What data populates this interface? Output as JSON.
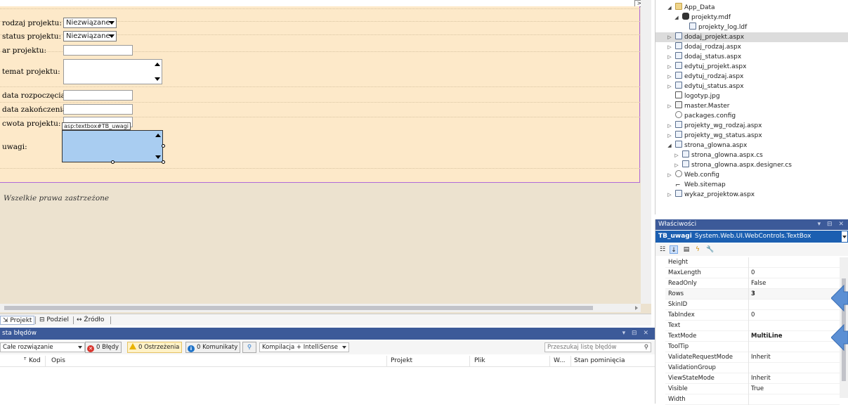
{
  "designer": {
    "glyph": ">",
    "form": [
      {
        "label": "rodzaj projektu:",
        "kind": "select",
        "value": "Niezwiązane"
      },
      {
        "label": "status projektu:",
        "kind": "select",
        "value": "Niezwiązane"
      },
      {
        "label": "ar projektu:",
        "kind": "textbox",
        "value": ""
      },
      {
        "label": "temat projektu:",
        "kind": "multiline",
        "value": ""
      },
      {
        "label": "data rozpoczęcia:",
        "kind": "textbox",
        "value": ""
      },
      {
        "label": "data zakończenia:",
        "kind": "textbox",
        "value": ""
      },
      {
        "label": "cwota projektu:",
        "kind": "textbox",
        "value": ""
      },
      {
        "label": "uwagi:",
        "kind": "multiline-selected",
        "value": ""
      }
    ],
    "selected_tag": "asp:textbox#TB_uwagi",
    "footer_text": "Wszelkie prawa zastrzeżone"
  },
  "view_tabs": {
    "projekt": "Projekt",
    "podziel": "Podziel",
    "zrodlo": "Źródło",
    "projekt_icon": "design-view-icon",
    "podziel_icon": "split-view-icon",
    "zrodlo_icon": "source-view-icon"
  },
  "error_list": {
    "title": "sta błędów",
    "title_controls": "▾ ⊟ ✕",
    "scope": "Całe rozwiązanie",
    "errors_btn": "0 Błędy",
    "warnings_btn": "0 Ostrzeżenia",
    "messages_btn": "0 Komunikaty",
    "build_filter": "Kompilacja + IntelliSense",
    "search_placeholder": "Przeszukaj listę błędów",
    "columns": [
      "Kod",
      "Opis",
      "Projekt",
      "Plik",
      "W...",
      "Stan pominięcia"
    ]
  },
  "solution_explorer": {
    "items": [
      {
        "label": "App_Data",
        "icon": "folder-icon",
        "expander": "◢",
        "level": 1
      },
      {
        "label": "projekty.mdf",
        "icon": "database-icon",
        "expander": "◢",
        "level": 2
      },
      {
        "label": "projekty_log.ldf",
        "icon": "file-link-icon",
        "expander": "",
        "level": 3
      },
      {
        "label": "dodaj_projekt.aspx",
        "icon": "aspx-file-icon",
        "expander": "▷",
        "level": 1,
        "selected": true
      },
      {
        "label": "dodaj_rodzaj.aspx",
        "icon": "aspx-file-icon",
        "expander": "▷",
        "level": 1
      },
      {
        "label": "dodaj_status.aspx",
        "icon": "aspx-file-icon",
        "expander": "▷",
        "level": 1
      },
      {
        "label": "edytuj_projekt.aspx",
        "icon": "aspx-file-icon",
        "expander": "▷",
        "level": 1
      },
      {
        "label": "edytuj_rodzaj.aspx",
        "icon": "aspx-file-icon",
        "expander": "▷",
        "level": 1
      },
      {
        "label": "edytuj_status.aspx",
        "icon": "aspx-file-icon",
        "expander": "▷",
        "level": 1
      },
      {
        "label": "logotyp.jpg",
        "icon": "image-file-icon",
        "expander": "",
        "level": 1
      },
      {
        "label": "master.Master",
        "icon": "master-page-icon",
        "expander": "▷",
        "level": 1
      },
      {
        "label": "packages.config",
        "icon": "config-file-icon",
        "expander": "",
        "level": 1
      },
      {
        "label": "projekty_wg_rodzaj.aspx",
        "icon": "aspx-file-icon",
        "expander": "▷",
        "level": 1
      },
      {
        "label": "projekty_wg_status.aspx",
        "icon": "aspx-file-icon",
        "expander": "▷",
        "level": 1
      },
      {
        "label": "strona_glowna.aspx",
        "icon": "aspx-file-icon",
        "expander": "◢",
        "level": 1
      },
      {
        "label": "strona_glowna.aspx.cs",
        "icon": "cs-file-icon",
        "expander": "▷",
        "level": 2
      },
      {
        "label": "strona_glowna.aspx.designer.cs",
        "icon": "cs-file-icon",
        "expander": "▷",
        "level": 2
      },
      {
        "label": "Web.config",
        "icon": "config-file-icon",
        "expander": "▷",
        "level": 1
      },
      {
        "label": "Web.sitemap",
        "icon": "sitemap-icon",
        "expander": "",
        "level": 1
      },
      {
        "label": "wykaz_projektow.aspx",
        "icon": "aspx-file-icon",
        "expander": "▷",
        "level": 1
      }
    ]
  },
  "properties": {
    "title": "Właściwości",
    "title_controls": "▾ ⊟ ✕",
    "object_name": "TB_uwagi",
    "object_type": "System.Web.UI.WebControls.TextBox",
    "toolbar": [
      "categorized-icon",
      "alphabetical-icon",
      "properties-icon",
      "events-icon",
      "property-pages-icon"
    ],
    "rows": [
      {
        "name": "Height",
        "value": ""
      },
      {
        "name": "MaxLength",
        "value": "0"
      },
      {
        "name": "ReadOnly",
        "value": "False"
      },
      {
        "name": "Rows",
        "value": "3",
        "bold": true
      },
      {
        "name": "SkinID",
        "value": ""
      },
      {
        "name": "TabIndex",
        "value": "0"
      },
      {
        "name": "Text",
        "value": ""
      },
      {
        "name": "TextMode",
        "value": "MultiLine",
        "bold": true
      },
      {
        "name": "ToolTip",
        "value": ""
      },
      {
        "name": "ValidateRequestMode",
        "value": "Inherit"
      },
      {
        "name": "ValidationGroup",
        "value": ""
      },
      {
        "name": "ViewStateMode",
        "value": "Inherit"
      },
      {
        "name": "Visible",
        "value": "True"
      },
      {
        "name": "Width",
        "value": ""
      }
    ]
  },
  "colors": {
    "form_bg": "#fde9c9",
    "designer_bg": "#ece2cf",
    "panel_title": "#3c5a99",
    "selection_blue": "#a9cdf1",
    "arrow_blue": "#5b8fd4"
  }
}
